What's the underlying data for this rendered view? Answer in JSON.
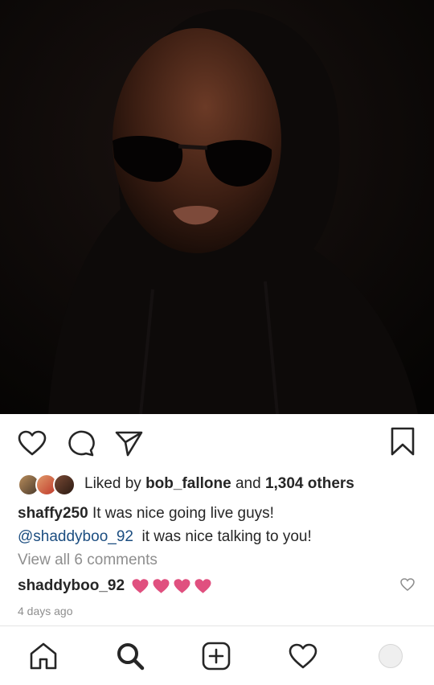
{
  "post": {
    "image_alt": "Man in dark hoodie wearing sunglasses",
    "likes": {
      "prefix": "Liked by",
      "first_user": "bob_fallone",
      "conjunction": "and",
      "others": "1,304 others"
    },
    "caption": {
      "username": "shaffy250",
      "text": "It was nice going live guys!",
      "mention": "@shaddyboo_92",
      "text2": "it was nice talking to you!"
    },
    "view_comments": "View all 6 comments",
    "comment": {
      "username": "shaddyboo_92",
      "emoji": "❤❤❤❤"
    },
    "timestamp": "4 days ago"
  },
  "icons": {
    "like": "heart-outline-icon",
    "comment": "speech-bubble-icon",
    "share": "paper-plane-icon",
    "save": "bookmark-icon"
  },
  "nav": {
    "items": [
      "home-icon",
      "search-icon",
      "new-post-icon",
      "activity-heart-icon",
      "profile-avatar"
    ]
  },
  "colors": {
    "heart_emoji": "#e0507f",
    "mention": "#1b4d80",
    "secondary_text": "#8e8e8e"
  }
}
